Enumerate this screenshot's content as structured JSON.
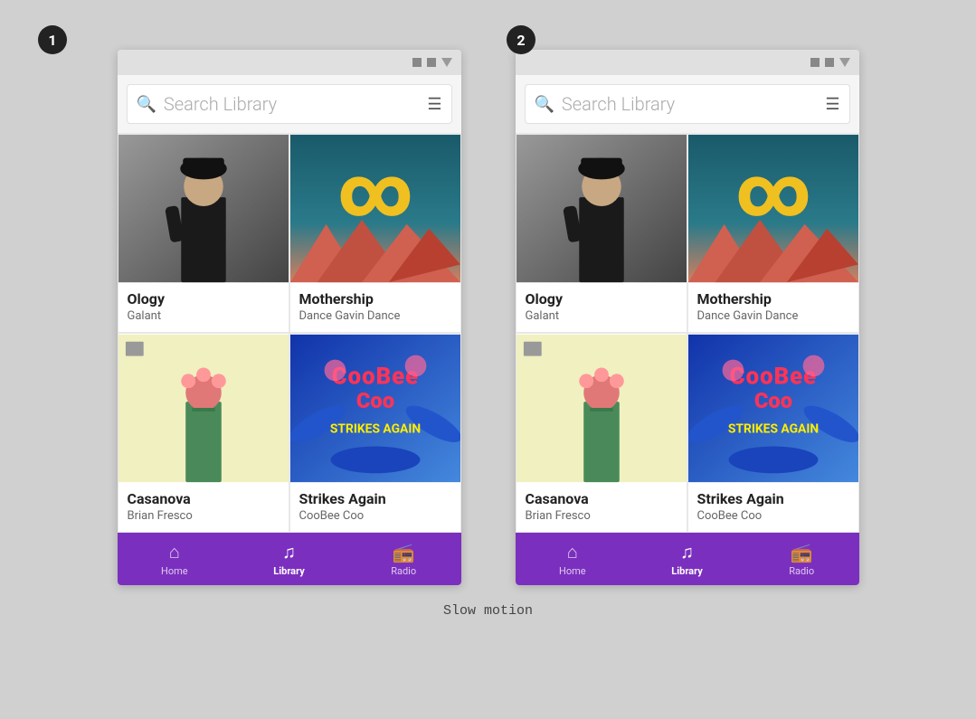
{
  "badges": [
    {
      "id": "badge-1",
      "label": "1"
    },
    {
      "id": "badge-2",
      "label": "2"
    }
  ],
  "screens": [
    {
      "id": "screen-1",
      "search": {
        "placeholder": "Search Library"
      },
      "albums": [
        {
          "title": "Ology",
          "artist": "Galant",
          "art": "ology"
        },
        {
          "title": "Mothership",
          "artist": "Dance Gavin Dance",
          "art": "mothership"
        },
        {
          "title": "Casanova",
          "artist": "Brian Fresco",
          "art": "casanova"
        },
        {
          "title": "Strikes Again",
          "artist": "CooBee Coo",
          "art": "strikes"
        }
      ],
      "nav": [
        {
          "label": "Home",
          "icon": "🏠",
          "active": false
        },
        {
          "label": "Library",
          "icon": "🎵",
          "active": true
        },
        {
          "label": "Radio",
          "icon": "📻",
          "active": false
        }
      ]
    },
    {
      "id": "screen-2",
      "search": {
        "placeholder": "Search Library"
      },
      "albums": [
        {
          "title": "Ology",
          "artist": "Galant",
          "art": "ology"
        },
        {
          "title": "Mothership",
          "artist": "Dance Gavin Dance",
          "art": "mothership"
        },
        {
          "title": "Casanova",
          "artist": "Brian Fresco",
          "art": "casanova"
        },
        {
          "title": "Strikes Again",
          "artist": "CooBee Coo",
          "art": "strikes"
        }
      ],
      "nav": [
        {
          "label": "Home",
          "icon": "🏠",
          "active": false
        },
        {
          "label": "Library",
          "icon": "🎵",
          "active": true
        },
        {
          "label": "Radio",
          "icon": "📻",
          "active": false
        }
      ]
    }
  ],
  "caption": "Slow motion"
}
